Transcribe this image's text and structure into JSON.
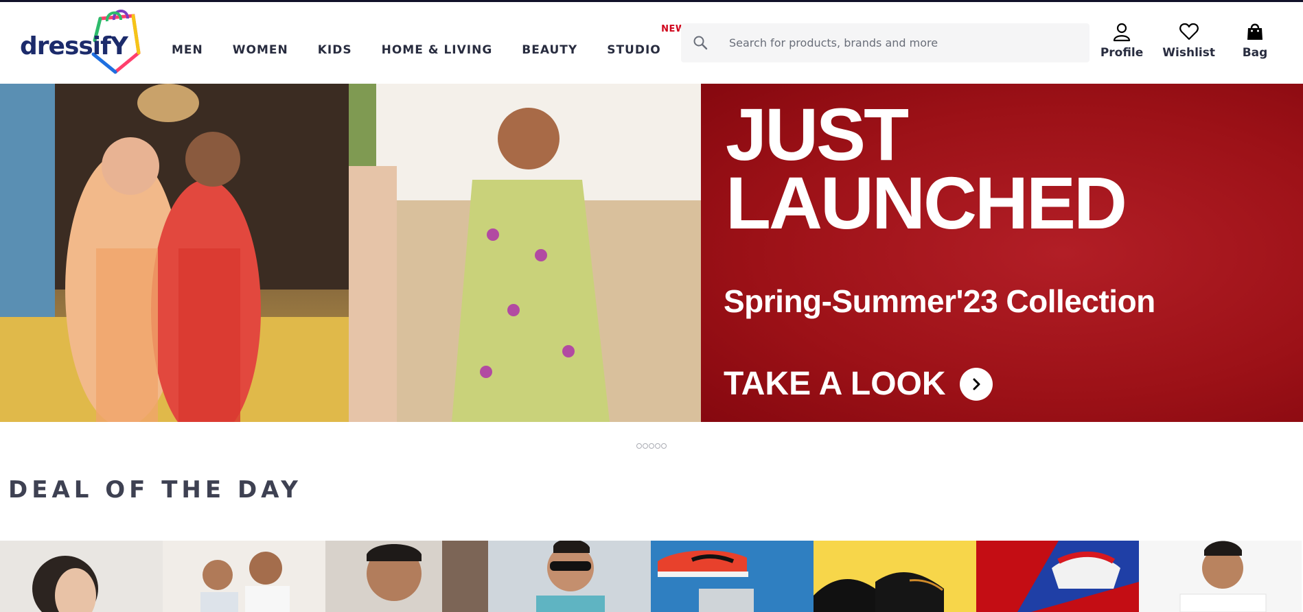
{
  "brand": {
    "name": "dressifY"
  },
  "nav": {
    "items": [
      {
        "label": "MEN"
      },
      {
        "label": "WOMEN"
      },
      {
        "label": "KIDS"
      },
      {
        "label": "HOME & LIVING"
      },
      {
        "label": "BEAUTY"
      },
      {
        "label": "STUDIO",
        "badge": "NEW"
      }
    ]
  },
  "search": {
    "placeholder": "Search for products, brands and more",
    "value": ""
  },
  "actions": {
    "profile": "Profile",
    "wishlist": "Wishlist",
    "bag": "Bag"
  },
  "hero": {
    "title_line1": "JUST",
    "title_line2": "LAUNCHED",
    "subtitle": "Spring-Summer'23 Collection",
    "cta": "TAKE A LOOK"
  },
  "carousel": {
    "slide_count": 5,
    "active_index": 0
  },
  "deal_of_the_day": {
    "title": "DEAL OF THE DAY",
    "tiles": [
      {
        "icon": "model-photo"
      },
      {
        "icon": "model-photo"
      },
      {
        "icon": "model-photo"
      },
      {
        "icon": "model-photo"
      },
      {
        "icon": "sneaker-photo"
      },
      {
        "icon": "shoe-photo"
      },
      {
        "icon": "sneaker-photo"
      },
      {
        "icon": "model-photo"
      }
    ]
  },
  "colors": {
    "accent_new": "#d0021b",
    "hero_red": "#9c1117",
    "brand_navy": "#1c2b6b"
  }
}
